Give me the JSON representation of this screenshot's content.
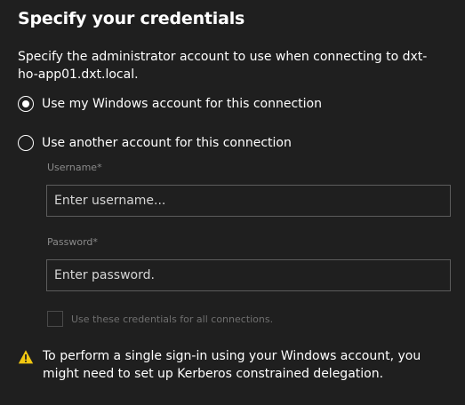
{
  "dialog": {
    "title": "Specify your credentials",
    "description": "Specify the administrator account to use when connecting to dxt-ho-app01.dxt.local.",
    "options": [
      {
        "label": "Use my Windows account for this connection",
        "selected": true
      },
      {
        "label": "Use another account for this connection",
        "selected": false
      }
    ],
    "username": {
      "label": "Username",
      "required_mark": "*",
      "placeholder": "Enter username...",
      "value": ""
    },
    "password": {
      "label": "Password",
      "required_mark": "*",
      "placeholder": "Enter password.",
      "value": ""
    },
    "checkbox": {
      "label": "Use these credentials for all connections.",
      "checked": false,
      "disabled": true
    },
    "warning": {
      "icon": "warning-icon",
      "text": "To perform a single sign-in using your Windows account, you might need to set up Kerberos constrained delegation."
    }
  },
  "colors": {
    "background": "#1f1f1f",
    "text": "#ffffff",
    "muted": "#8a8a8a",
    "warning": "#f2c811"
  }
}
